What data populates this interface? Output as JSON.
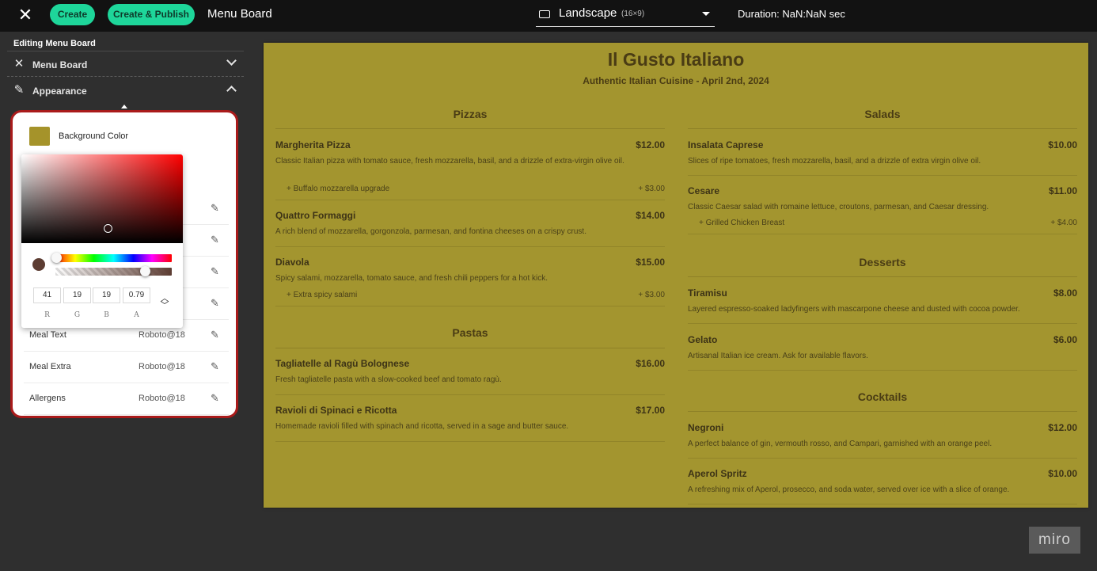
{
  "topbar": {
    "close_icon": "close-icon",
    "create_label": "Create",
    "publish_label": "Create & Publish",
    "title": "Menu Board",
    "layout_label": "Landscape",
    "layout_sub": "(16×9)",
    "duration": "Duration: NaN:NaN sec"
  },
  "sidebar": {
    "heading": "Editing Menu Board",
    "sections": [
      {
        "label": "Menu Board",
        "icon": "utensils-icon"
      },
      {
        "label": "Appearance",
        "icon": "eyedropper-icon"
      }
    ],
    "bg_label": "Background Color",
    "bg_color": "#a5932a",
    "fonts": [
      {
        "name": "Meal Text",
        "value": "Roboto@18"
      },
      {
        "name": "Meal Extra",
        "value": "Roboto@18"
      },
      {
        "name": "Allergens",
        "value": "Roboto@18"
      }
    ]
  },
  "picker": {
    "r": "41",
    "g": "19",
    "b": "19",
    "a": "0.79",
    "labels": [
      "R",
      "G",
      "B",
      "A"
    ],
    "toggle": "⌃⌄"
  },
  "board": {
    "title": "Il Gusto Italiano",
    "subtitle": "Authentic Italian Cuisine - April 2nd, 2024",
    "pizzas": {
      "title": "Pizzas",
      "items": [
        {
          "name": "Margherita Pizza",
          "price": "$12.00",
          "desc": "Classic Italian pizza with tomato sauce, fresh mozzarella, basil, and a drizzle of extra-virgin olive oil.",
          "extra": "+ Buffalo mozzarella upgrade",
          "extra_price": "+ $3.00"
        },
        {
          "name": "Quattro Formaggi",
          "price": "$14.00",
          "desc": "A rich blend of mozzarella, gorgonzola, parmesan, and fontina cheeses on a crispy crust."
        },
        {
          "name": "Diavola",
          "price": "$15.00",
          "desc": "Spicy salami, mozzarella, tomato sauce, and fresh chili peppers for a hot kick.",
          "extra": "+ Extra spicy salami",
          "extra_price": "+ $3.00"
        }
      ]
    },
    "pastas": {
      "title": "Pastas",
      "items": [
        {
          "name": "Tagliatelle al Ragù Bolognese",
          "price": "$16.00",
          "desc": "Fresh tagliatelle pasta with a slow-cooked beef and tomato ragù."
        },
        {
          "name": "Ravioli di Spinaci e Ricotta",
          "price": "$17.00",
          "desc": "Homemade ravioli filled with spinach and ricotta, served in a sage and butter sauce."
        }
      ]
    },
    "salads": {
      "title": "Salads",
      "items": [
        {
          "name": "Insalata Caprese",
          "price": "$10.00",
          "desc": "Slices of ripe tomatoes, fresh mozzarella, basil, and a drizzle of extra virgin olive oil."
        },
        {
          "name": "Cesare",
          "price": "$11.00",
          "desc": "Classic Caesar salad with romaine lettuce, croutons, parmesan, and Caesar dressing.",
          "extra": "+ Grilled Chicken Breast",
          "extra_price": "+ $4.00"
        }
      ]
    },
    "desserts": {
      "title": "Desserts",
      "items": [
        {
          "name": "Tiramisu",
          "price": "$8.00",
          "desc": "Layered espresso-soaked ladyfingers with mascarpone cheese and dusted with cocoa powder."
        },
        {
          "name": "Gelato",
          "price": "$6.00",
          "desc": "Artisanal Italian ice cream. Ask for available flavors."
        }
      ]
    },
    "cocktails": {
      "title": "Cocktails",
      "items": [
        {
          "name": "Negroni",
          "price": "$12.00",
          "desc": "A perfect balance of gin, vermouth rosso, and Campari, garnished with an orange peel."
        },
        {
          "name": "Aperol Spritz",
          "price": "$10.00",
          "desc": "A refreshing mix of Aperol, prosecco, and soda water, served over ice with a slice of orange."
        }
      ]
    }
  },
  "watermark": "miro",
  "colors": {
    "accent": "#1ed69a",
    "board_bg": "#a3952f",
    "highlight": "#a91b1b"
  }
}
